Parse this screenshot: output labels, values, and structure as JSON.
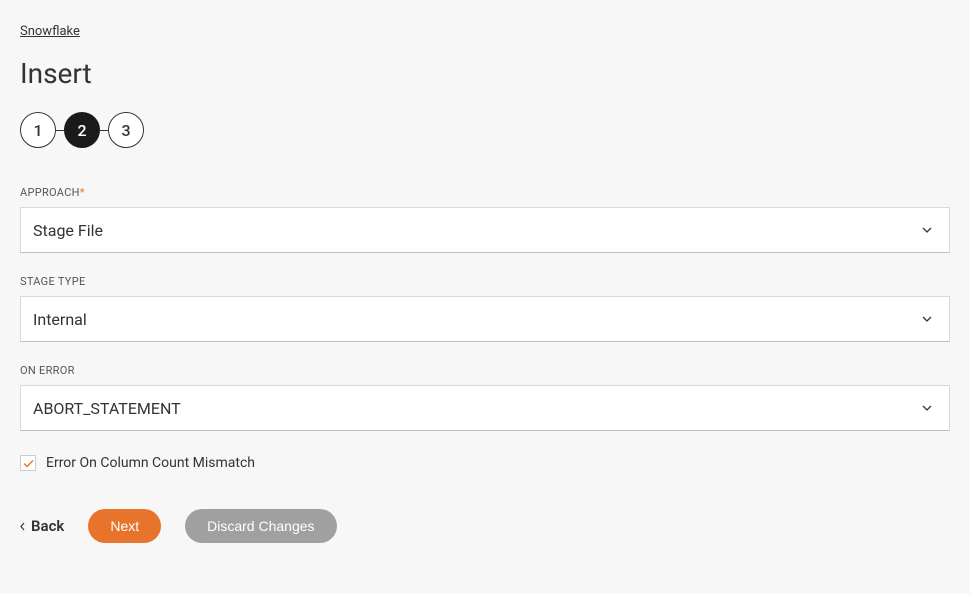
{
  "breadcrumb": "Snowflake",
  "title": "Insert",
  "stepper": {
    "steps": [
      "1",
      "2",
      "3"
    ],
    "active_index": 1
  },
  "fields": {
    "approach": {
      "label": "APPROACH",
      "required": true,
      "value": "Stage File"
    },
    "stage_type": {
      "label": "STAGE TYPE",
      "required": false,
      "value": "Internal"
    },
    "on_error": {
      "label": "ON ERROR",
      "required": false,
      "value": "ABORT_STATEMENT"
    }
  },
  "checkbox": {
    "label": "Error On Column Count Mismatch",
    "checked": true
  },
  "buttons": {
    "back": "Back",
    "next": "Next",
    "discard": "Discard Changes"
  }
}
